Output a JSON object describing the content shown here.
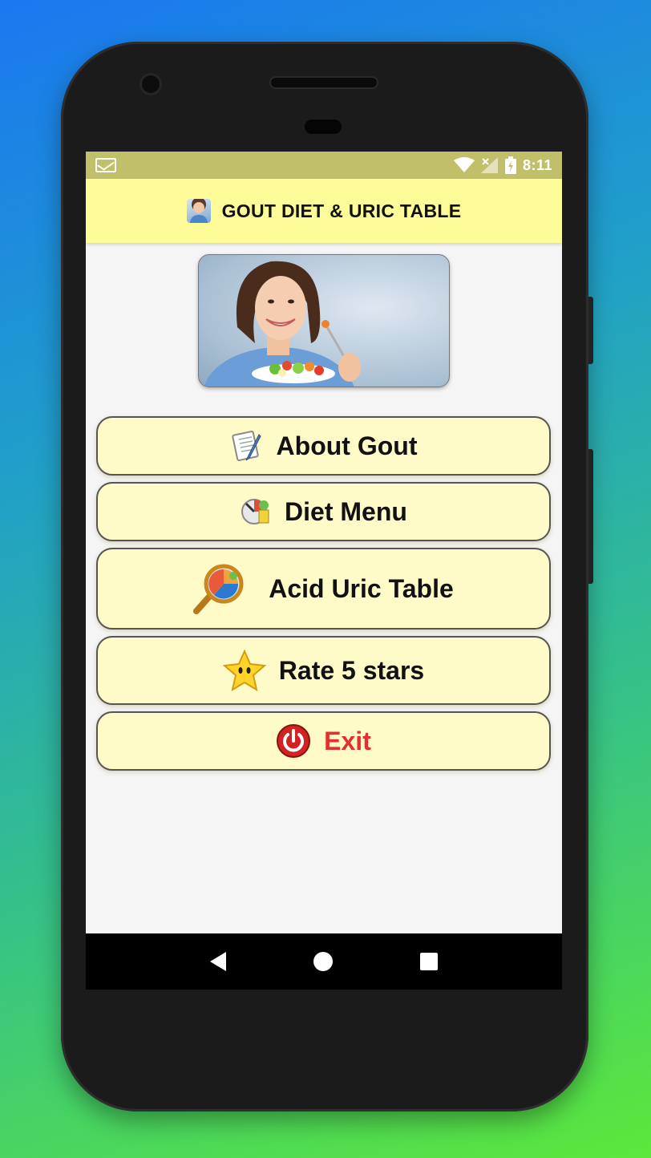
{
  "status_bar": {
    "notification_icon": "gmail-icon",
    "wifi_icon": "wifi-icon",
    "signal_icon": "signal-icon",
    "battery_icon": "battery-icon",
    "time": "8:11"
  },
  "app_bar": {
    "logo_icon": "app-logo-icon",
    "title": "GOUT DIET & URIC TABLE",
    "background": "#fdfc98"
  },
  "hero": {
    "image": "woman-eating-salad-photo"
  },
  "menu": {
    "items": [
      {
        "label": "About Gout",
        "icon": "notebook-pencil-icon"
      },
      {
        "label": "Diet Menu",
        "icon": "diet-scale-icon"
      },
      {
        "label": "Acid Uric Table",
        "icon": "magnifier-chart-icon"
      },
      {
        "label": "Rate 5 stars",
        "icon": "star-icon"
      },
      {
        "label": "Exit",
        "icon": "power-icon"
      }
    ],
    "button_color": "#fffbc8",
    "exit_color": "#e62e2e"
  },
  "nav_bar": {
    "back_icon": "back-icon",
    "home_icon": "home-icon",
    "recents_icon": "recents-icon"
  },
  "colors": {
    "status_bar": "#c2bf6a",
    "screen_background": "#f5f5f5"
  }
}
